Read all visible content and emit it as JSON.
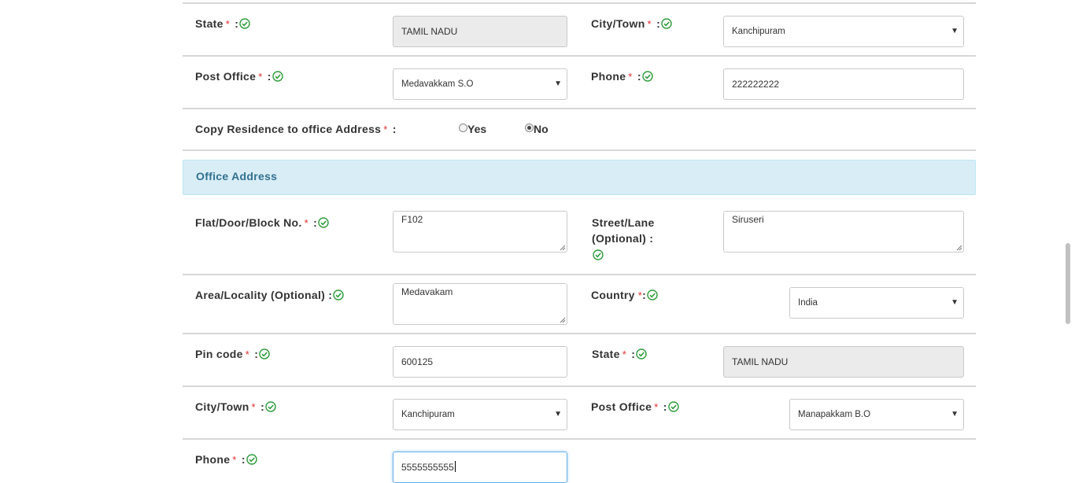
{
  "colors": {
    "required": "#e32b2b",
    "check": "#2e9b3a",
    "banner_bg": "#d9edf7",
    "banner_text": "#31708f"
  },
  "residence": {
    "state_label": "State",
    "state_value": "TAMIL NADU",
    "city_label": "City/Town",
    "city_value": "Kanchipuram",
    "post_office_label": "Post Office",
    "post_office_value": "Medavakkam S.O",
    "phone_label": "Phone",
    "phone_value": "222222222"
  },
  "copy": {
    "label": "Copy Residence to office Address",
    "suffix": " :",
    "yes": "Yes",
    "no": "No",
    "selected": "No"
  },
  "office": {
    "heading": "Office Address",
    "flat_label": "Flat/Door/Block No.",
    "flat_value": "F102",
    "street_label_1": "Street/Lane",
    "street_label_2": "(Optional) :",
    "street_value": "Siruseri",
    "area_label": "Area/Locality (Optional) :",
    "area_value": "Medavakam",
    "country_label": "Country",
    "country_value": "India",
    "pin_label": "Pin code",
    "pin_value": "600125",
    "state_label": "State",
    "state_value": "TAMIL NADU",
    "city_label": "City/Town",
    "city_value": "Kanchipuram",
    "post_office_label": "Post Office",
    "post_office_value": "Manapakkam B.O",
    "phone_label": "Phone",
    "phone_value": "5555555555"
  },
  "common": {
    "required_mark": "*",
    "colon": " :"
  },
  "icons": {
    "check": "check-circle-icon",
    "caret": "caret-down-icon",
    "resize": "resize-grip-icon"
  }
}
